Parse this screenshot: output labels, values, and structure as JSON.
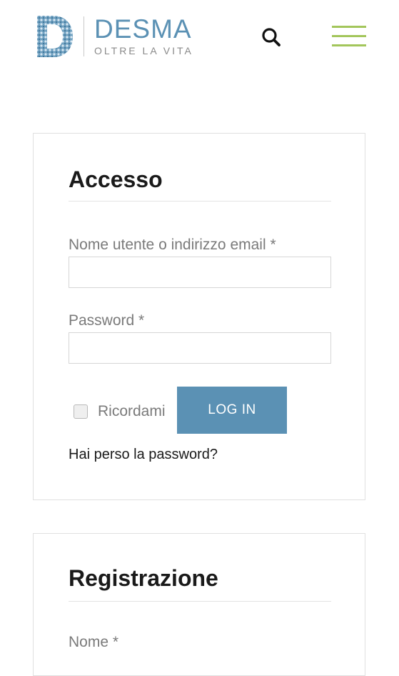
{
  "header": {
    "logo": {
      "name": "DESMA",
      "tagline": "OLTRE LA VITA",
      "letter": "D"
    },
    "icons": {
      "search": "search-icon",
      "menu": "hamburger-menu-icon"
    },
    "colors": {
      "brand_blue": "#5b91b4",
      "menu_green": "#a3c65b"
    }
  },
  "login": {
    "title": "Accesso",
    "username_label": "Nome utente o indirizzo email *",
    "username_value": "",
    "password_label": "Password *",
    "password_value": "",
    "remember_label": "Ricordami",
    "remember_checked": false,
    "submit_label": "LOG IN",
    "lost_password_link": "Hai perso la password?"
  },
  "register": {
    "title": "Registrazione",
    "name_label": "Nome *"
  }
}
